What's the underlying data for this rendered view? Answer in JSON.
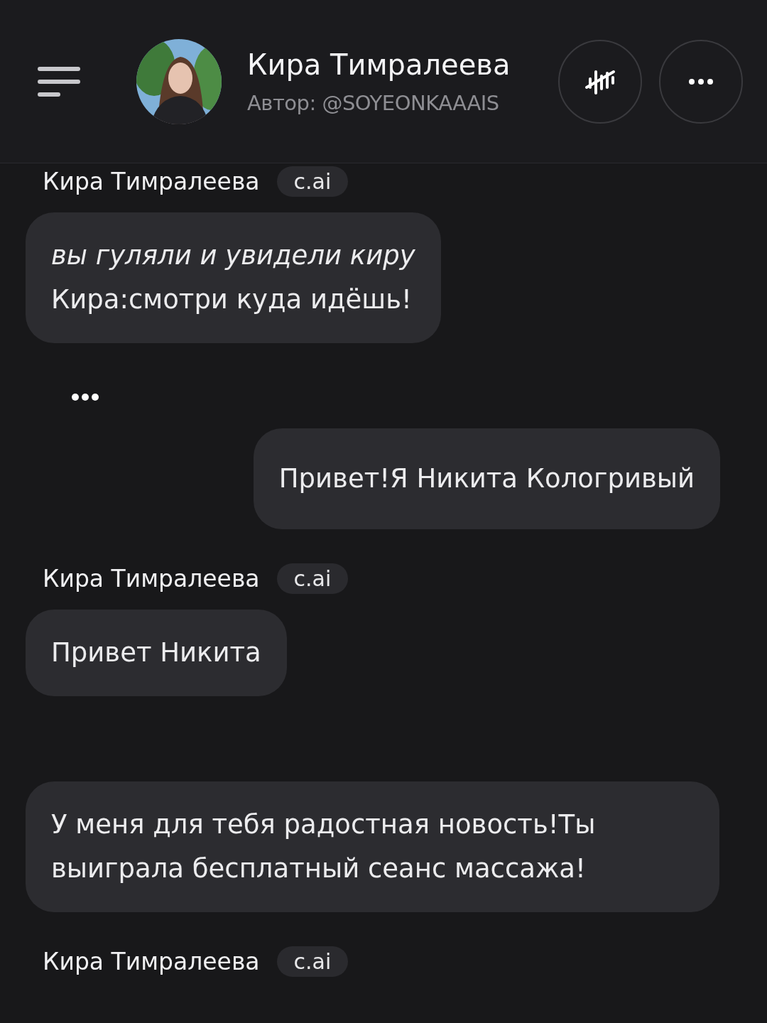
{
  "header": {
    "name": "Кира Тимралеева",
    "author": "Автор: @SOYEONKAAAIS"
  },
  "messages": [
    {
      "kind": "label",
      "name": "Кира Тимралеева",
      "badge": "c.ai"
    },
    {
      "kind": "bot",
      "text": "*вы гуляли и увидели киру*\nКира:смотри куда идёшь!"
    },
    {
      "kind": "typing"
    },
    {
      "kind": "user",
      "text": "Привет!Я Никита Кологривый"
    },
    {
      "kind": "label",
      "name": "Кира Тимралеева",
      "badge": "c.ai"
    },
    {
      "kind": "bot",
      "text": "Привет Никита"
    },
    {
      "kind": "bot",
      "text": "У меня для тебя радостная новость!Ты выиграла бесплатный сеанс массажа!"
    },
    {
      "kind": "label",
      "name": "Кира Тимралеева",
      "badge": "c.ai"
    }
  ]
}
